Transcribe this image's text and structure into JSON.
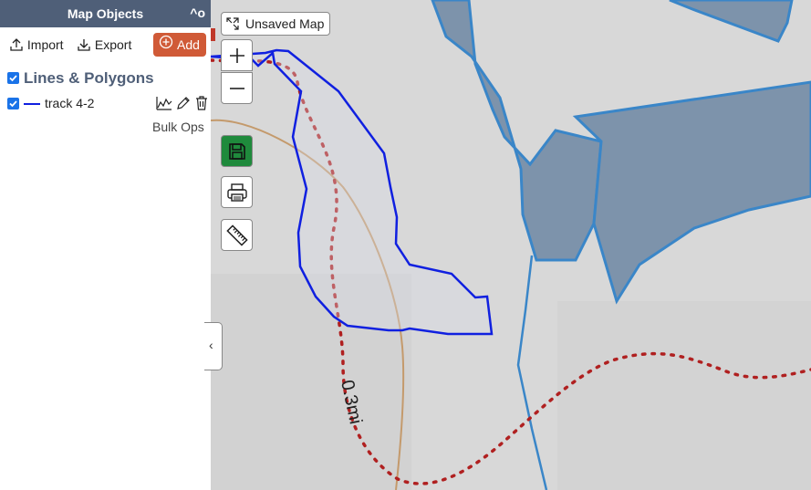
{
  "sidebar": {
    "title": "Map Objects",
    "collapse_label": "^o",
    "toolbar": {
      "import_label": "Import",
      "export_label": "Export",
      "add_label": "Add"
    },
    "group": {
      "label": "Lines & Polygons",
      "checked": true
    },
    "tracks": [
      {
        "label": "track 4-2",
        "checked": true,
        "color": "#1020e0"
      }
    ],
    "bulk_ops_label": "Bulk Ops",
    "toggle_icon": "chevron-left-icon"
  },
  "map": {
    "unsaved_label": "Unsaved Map",
    "distance_label": "0.3mi",
    "controls": [
      "zoom-in",
      "zoom-out",
      "save",
      "print",
      "measure"
    ],
    "colors": {
      "track": "#1020e0",
      "trail": "#c0392b",
      "water": "#7d93ab",
      "stream": "#3a86c8",
      "contour": "#c49a6c",
      "save": "#1f8a3c",
      "add": "#d05a37",
      "header": "#4f5f78"
    }
  }
}
